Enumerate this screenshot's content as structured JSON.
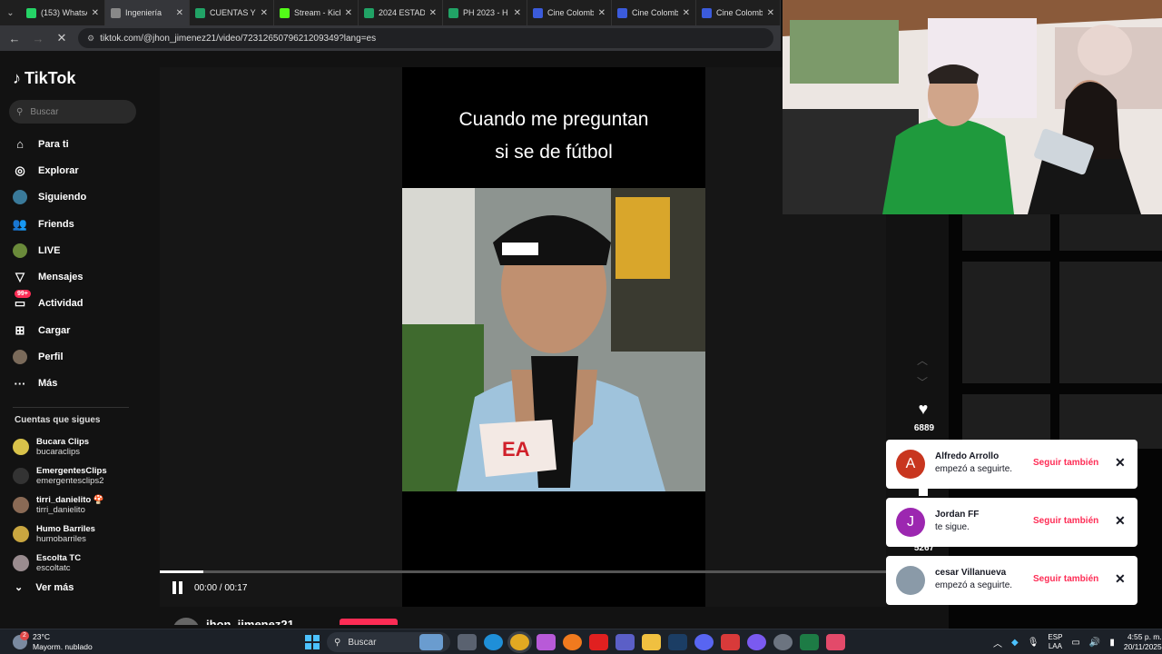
{
  "browser": {
    "tabs": [
      {
        "label": "(153) WhatsApp",
        "color": "#25d366",
        "active": false
      },
      {
        "label": "Ingeniería",
        "color": "#888888",
        "active": true
      },
      {
        "label": "CUENTAS Y",
        "color": "#21a366",
        "active": false
      },
      {
        "label": "Stream - Kick",
        "color": "#53fc18",
        "active": false
      },
      {
        "label": "2024 ESTAD",
        "color": "#21a366",
        "active": false
      },
      {
        "label": "PH 2023 - H",
        "color": "#21a366",
        "active": false
      },
      {
        "label": "Cine Colombi",
        "color": "#3b5bdb",
        "active": false
      },
      {
        "label": "Cine Colombi",
        "color": "#3b5bdb",
        "active": false
      },
      {
        "label": "Cine Colombi",
        "color": "#3b5bdb",
        "active": false
      }
    ],
    "tab_close": "✕",
    "url": "tiktok.com/@jhon_jimenez21/video/7231265079621209349?lang=es"
  },
  "sidebar": {
    "logo_text": "TikTok",
    "search_placeholder": "Buscar",
    "menu": [
      {
        "label": "Para ti",
        "icon": "home-icon",
        "glyph": "⌂"
      },
      {
        "label": "Explorar",
        "icon": "compass-icon",
        "glyph": "◎"
      },
      {
        "label": "Siguiendo",
        "icon": "following-avatar-icon",
        "glyph": ""
      },
      {
        "label": "Friends",
        "icon": "friends-icon",
        "glyph": "👥"
      },
      {
        "label": "LIVE",
        "icon": "live-avatar-icon",
        "glyph": ""
      },
      {
        "label": "Mensajes",
        "icon": "send-icon",
        "glyph": "▽"
      },
      {
        "label": "Actividad",
        "icon": "activity-icon",
        "glyph": "▭",
        "badge": "99+"
      },
      {
        "label": "Cargar",
        "icon": "upload-icon",
        "glyph": "⊞"
      },
      {
        "label": "Perfil",
        "icon": "profile-avatar-icon",
        "glyph": ""
      },
      {
        "label": "Más",
        "icon": "more-icon",
        "glyph": "···"
      }
    ],
    "following_title": "Cuentas que sigues",
    "following": [
      {
        "name": "Bucara Clips",
        "handle": "bucaraclips",
        "color": "#d8c24a"
      },
      {
        "name": "EmergentesClips",
        "handle": "emergentesclips2",
        "color": "#333333"
      },
      {
        "name": "tirri_danielito 🍄",
        "handle": "tirri_danielito",
        "color": "#8a6a55"
      },
      {
        "name": "Humo Barriles",
        "handle": "humobarriles",
        "color": "#c9a640"
      },
      {
        "name": "Escolta TC",
        "handle": "escoltatc",
        "color": "#9a8c8f"
      }
    ],
    "see_more": "Ver más"
  },
  "video": {
    "caption_line1": "Cuando me preguntan",
    "caption_line2": "si se de fútbol",
    "time": "00:00 / 00:17",
    "progress": 0.06,
    "author": "jhon_jimenez21"
  },
  "actions": {
    "likes": "6889",
    "saves": "5267"
  },
  "notifications": [
    {
      "name": "Alfredo Arrollo",
      "text": "empezó a seguirte.",
      "button": "Seguir también",
      "initial": "A",
      "color": "#c8361f"
    },
    {
      "name": "Jordan FF",
      "text": "te sigue.",
      "button": "Seguir también",
      "initial": "J",
      "color": "#9c27b0"
    },
    {
      "name": "cesar Villanueva",
      "text": "empezó a seguirte.",
      "button": "Seguir también",
      "initial": "",
      "color": "#8a9aa8"
    }
  ],
  "taskbar": {
    "weather_temp": "23°C",
    "weather_desc": "Mayorm. nublado",
    "weather_badge": "2",
    "search_label": "Buscar",
    "lang_top": "ESP",
    "lang_bottom": "LAA",
    "time": "4:55 p. m.",
    "date": "20/11/2025"
  }
}
